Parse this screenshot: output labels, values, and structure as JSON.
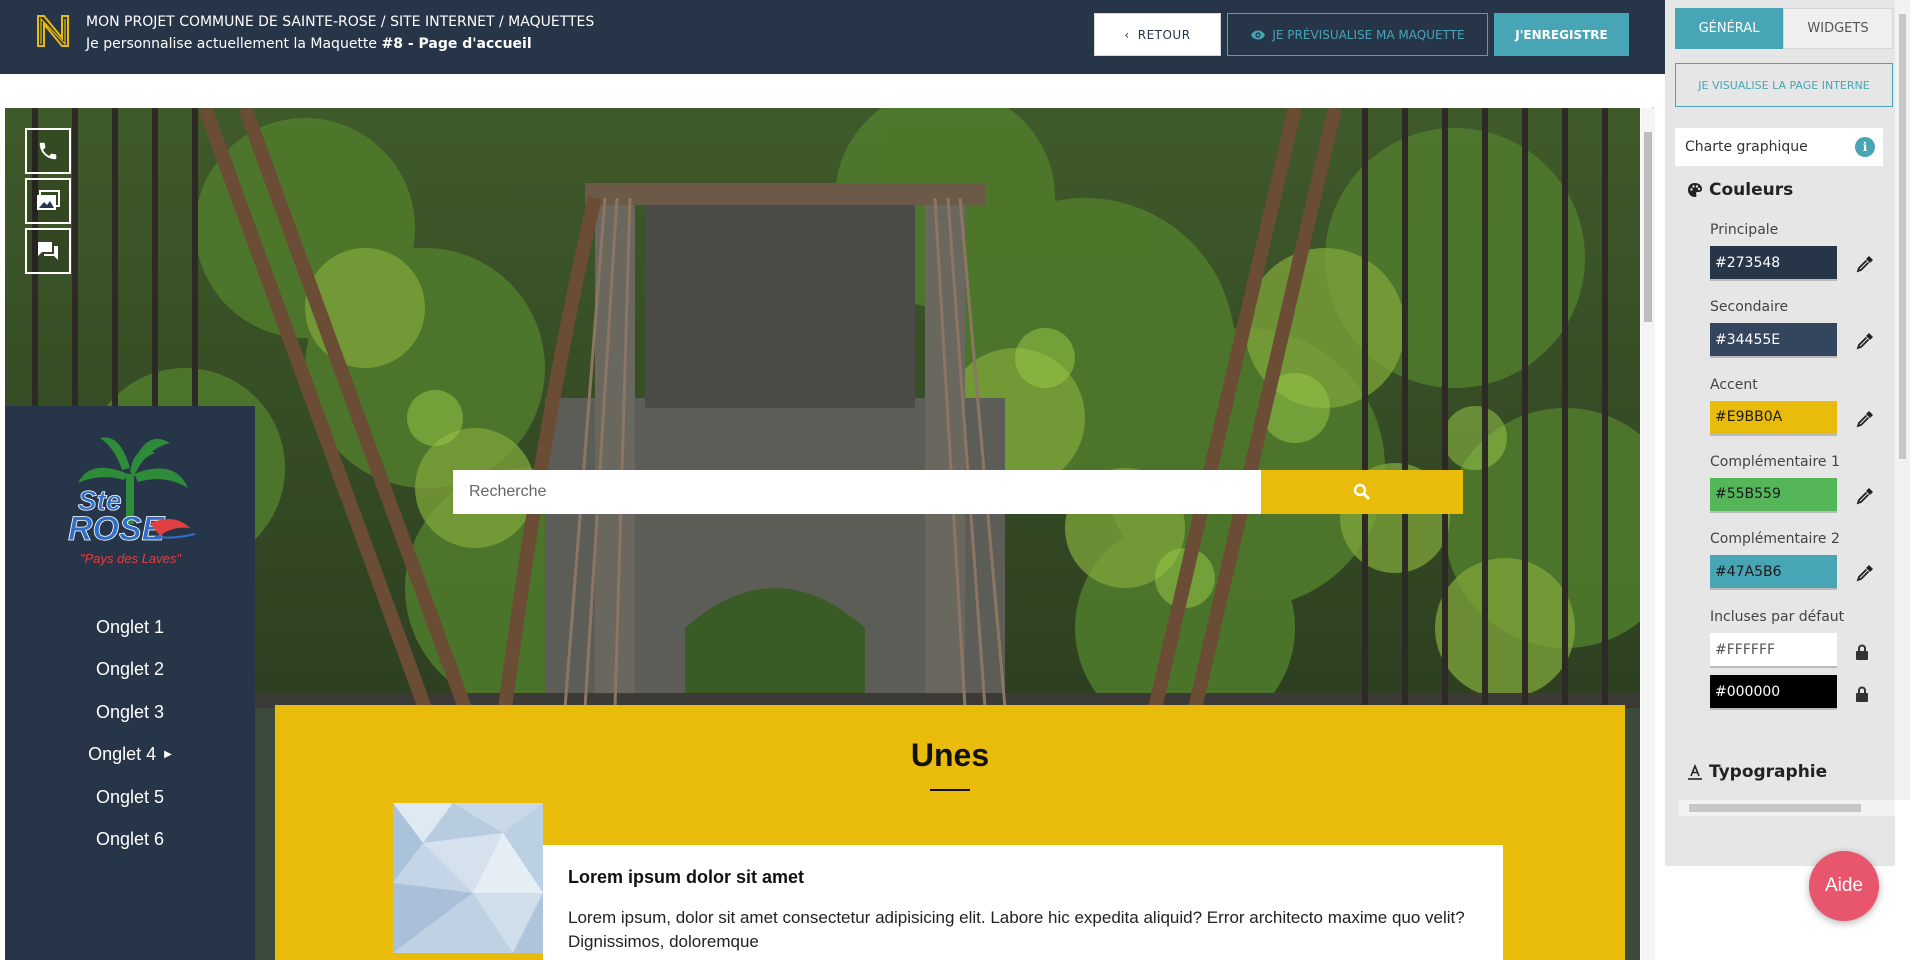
{
  "header": {
    "breadcrumb": "MON PROJET COMMUNE DE SAINTE-ROSE / SITE INTERNET / MAQUETTES",
    "subtitle_prefix": "Je personnalise actuellement la Maquette ",
    "subtitle_bold": "#8 - Page d'accueil",
    "back_label": "RETOUR",
    "preview_label": "JE PRÉVISUALISE MA MAQUETTE",
    "save_label": "J'ENREGISTRE"
  },
  "site": {
    "logo_text_top": "Ste",
    "logo_text_main": "ROSE",
    "logo_tagline": "\"Pays des Laves\"",
    "quick_icons": [
      "phone-icon",
      "gallery-icon",
      "chat-icon"
    ],
    "nav": [
      {
        "label": "Onglet 1",
        "has_submenu": false
      },
      {
        "label": "Onglet 2",
        "has_submenu": false
      },
      {
        "label": "Onglet 3",
        "has_submenu": false
      },
      {
        "label": "Onglet 4",
        "has_submenu": true
      },
      {
        "label": "Onglet 5",
        "has_submenu": false
      },
      {
        "label": "Onglet 6",
        "has_submenu": false
      }
    ],
    "search_placeholder": "Recherche",
    "unes_title": "Unes",
    "card_title": "Lorem ipsum dolor sit amet",
    "card_text": "Lorem ipsum, dolor sit amet consectetur adipisicing elit. Labore hic expedita aliquid? Error architecto maxime quo velit? Dignissimos, doloremque"
  },
  "panel": {
    "tabs": [
      {
        "label": "GÉNÉRAL",
        "active": true
      },
      {
        "label": "WIDGETS",
        "active": false
      }
    ],
    "internal_page_label": "JE VISUALISE LA PAGE INTERNE",
    "charte_label": "Charte graphique",
    "colors_title": "Couleurs",
    "colors": [
      {
        "label": "Principale",
        "value": "#273548"
      },
      {
        "label": "Secondaire",
        "value": "#34455E"
      },
      {
        "label": "Accent",
        "value": "#E9BB0A"
      },
      {
        "label": "Complémentaire 1",
        "value": "#55B559"
      },
      {
        "label": "Complémentaire 2",
        "value": "#47A5B6"
      }
    ],
    "defaults_label": "Incluses par défaut",
    "default_colors": [
      "#FFFFFF",
      "#000000"
    ],
    "typography_title": "Typographie"
  },
  "aide_label": "Aide",
  "theme": {
    "primary": "#273548",
    "secondary": "#34455E",
    "accent": "#E9BB0A",
    "complementary1": "#55B559",
    "complementary2": "#47A5B6",
    "aide": "#E8566E"
  }
}
